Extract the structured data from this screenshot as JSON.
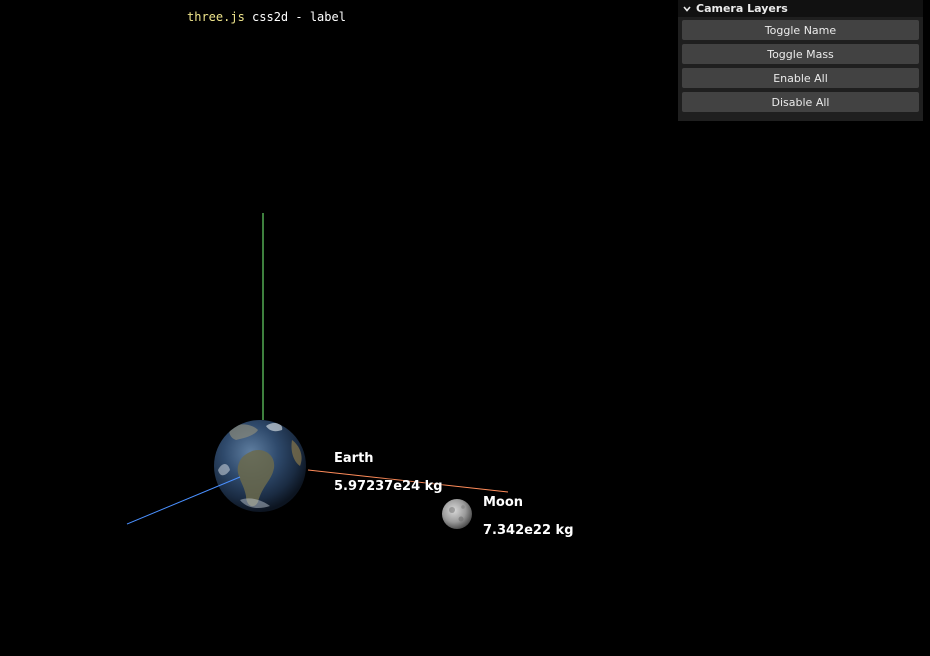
{
  "info": {
    "brand": "three.js",
    "text": " css2d - label"
  },
  "gui": {
    "title": "Camera Layers",
    "buttons": [
      {
        "label": "Toggle Name"
      },
      {
        "label": "Toggle Mass"
      },
      {
        "label": "Enable All"
      },
      {
        "label": "Disable All"
      }
    ]
  },
  "bodies": {
    "earth": {
      "name": "Earth",
      "mass": "5.97237e24 kg"
    },
    "moon": {
      "name": "Moon",
      "mass": "7.342e22 kg"
    }
  },
  "colors": {
    "background": "#000000",
    "axis_x": "#ff8c5a",
    "axis_y": "#7cff7c",
    "axis_z": "#4a90ff",
    "panel": "#1f1f1f",
    "button": "#424242"
  }
}
